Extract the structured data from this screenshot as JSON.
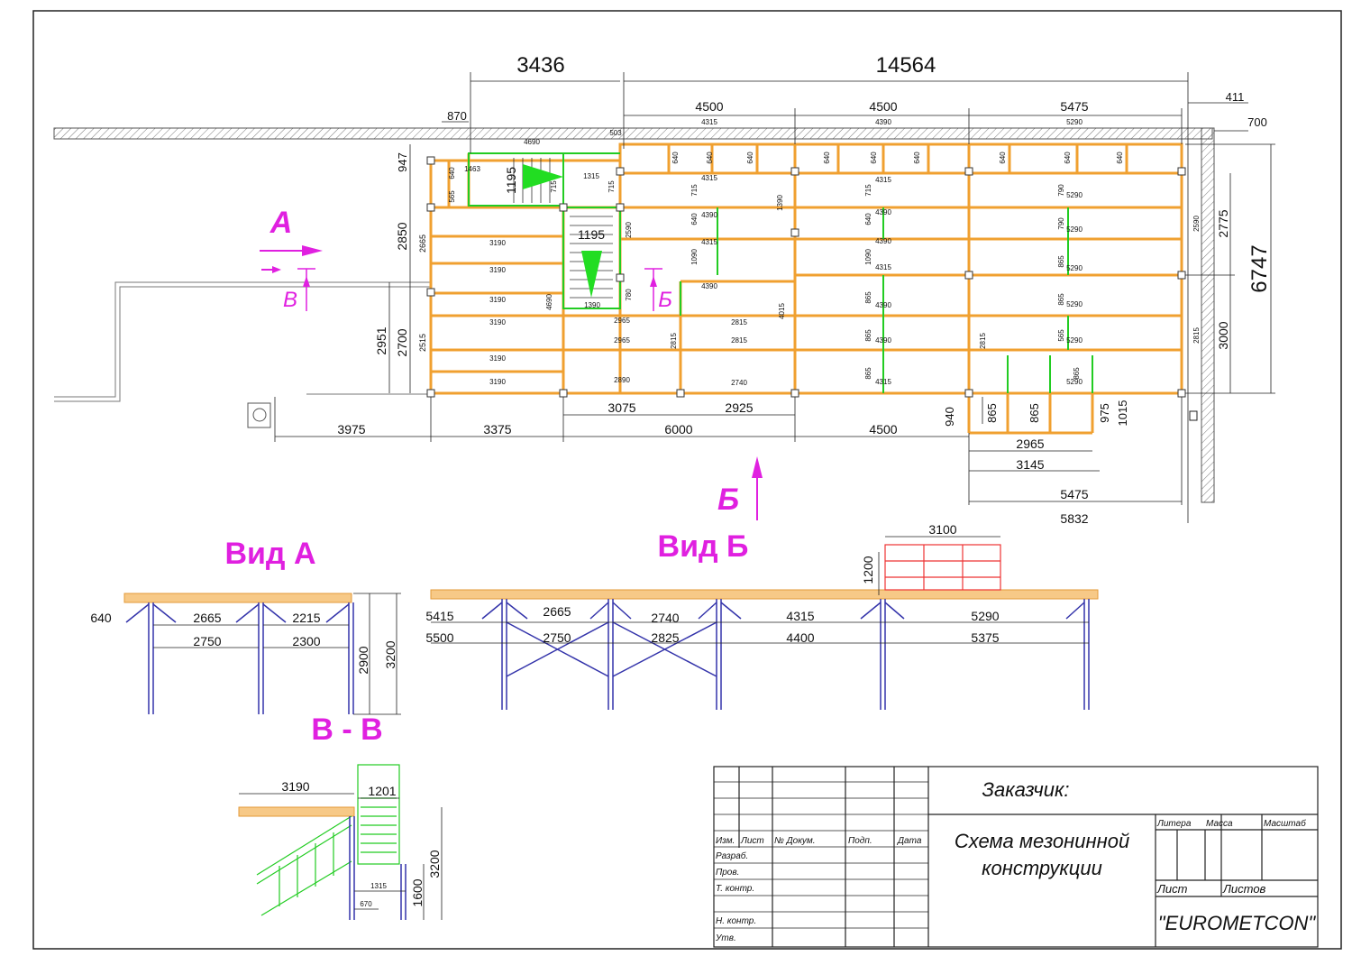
{
  "plan": {
    "top_dims": {
      "d1": "3436",
      "d2": "14564",
      "d3": "411",
      "d4": "700",
      "d5": "870",
      "d6": "503",
      "d7": "4690"
    },
    "bay_dims": {
      "a": "4500",
      "b": "4500",
      "c": "5475",
      "a_in": "4315",
      "b_in": "4390",
      "c_in": "5290"
    },
    "left_dims": {
      "d947": "947",
      "d2850": "2850",
      "d2665": "2665",
      "d2951": "2951",
      "d2700": "2700",
      "d2515": "2515"
    },
    "right_dims": {
      "d2775": "2775",
      "d3000": "3000",
      "d6747": "6747",
      "d2590": "2590",
      "d2815": "2815"
    },
    "bottom_dims": {
      "d3975": "3975",
      "d3375": "3375",
      "d6000": "6000",
      "d4500": "4500",
      "d3075": "3075",
      "d2925": "2925",
      "d2965": "2965",
      "d3145": "3145",
      "d5475": "5475",
      "d5832": "5832",
      "d940": "940",
      "d865a": "865",
      "d865b": "865",
      "d975": "975",
      "d1015": "1015"
    },
    "beam_labels": {
      "b3190": "3190",
      "b2965": "2965",
      "b2815": "2815",
      "b2890": "2890",
      "b2740": "2740",
      "b1390": "1390",
      "b1195": "1195",
      "b1315": "1315",
      "b4390": "4390",
      "b4315": "4315",
      "b5290": "5290",
      "b640": "640",
      "b715": "715",
      "b865": "865",
      "b1090": "1090",
      "b790": "790",
      "b4015": "4015",
      "b4690": "4690",
      "b1463": "1463",
      "b565": "565",
      "b780": "780"
    },
    "markers": {
      "a": "А",
      "b": "Б",
      "v": "В"
    }
  },
  "view_a": {
    "title": "Вид А",
    "dims": {
      "top1": "2665",
      "top2": "2215",
      "bot1": "2750",
      "bot2": "2300",
      "left": "640",
      "h1": "2900",
      "h2": "3200"
    }
  },
  "view_b": {
    "title": "Вид Б",
    "dims": {
      "t1": "5415",
      "t2": "2665",
      "t3": "2740",
      "t4": "4315",
      "t5": "5290",
      "b1": "5500",
      "b2": "2750",
      "b3": "2825",
      "b4": "4400",
      "b5": "5375",
      "rail_w": "3100",
      "rail_h": "1200"
    }
  },
  "section_vv": {
    "title": "В - В",
    "dims": {
      "w1": "3190",
      "w2": "1201",
      "h": "3200",
      "h2": "1600",
      "s1": "1315",
      "s2": "670"
    }
  },
  "title_block": {
    "customer_label": "Заказчик:",
    "drawing_name_line1": "Схема  мезонинной",
    "drawing_name_line2": "конструкции",
    "company": "\"EUROMETCON\"",
    "col_izm": "Изм.",
    "col_list": "Лист",
    "col_doc": "№ Докум.",
    "col_podp": "Подп.",
    "col_data": "Дата",
    "razrab": "Разраб.",
    "prov": "Пров.",
    "tkontr": "Т. контр.",
    "nkontr": "Н. контр.",
    "utv": "Утв.",
    "litera": "Литера",
    "massa": "Масса",
    "masshtab": "Масштаб",
    "list2": "Лист",
    "listov": "Листов"
  },
  "colors": {
    "beam": "#f0a030",
    "green": "#22cc22",
    "magenta": "#e020e0",
    "blue": "#3333aa",
    "red": "#ee3333"
  }
}
